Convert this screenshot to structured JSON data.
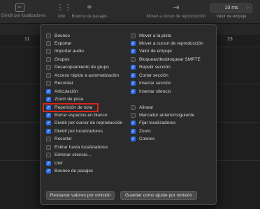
{
  "toolbar": {
    "split_label": "Dividir por localizadores",
    "glue_label": "Unir",
    "bounce_label": "Bounce de pasajes",
    "playhead_label": "Mover a cursor de reproducción",
    "nudge_value": "10 ms",
    "nudge_label": "Valor de empuje"
  },
  "ruler": {
    "left_bar": "11",
    "right_bar": "23"
  },
  "popover": {
    "left_column": [
      {
        "label": "Bounce",
        "checked": false
      },
      {
        "label": "Exportar",
        "checked": false
      },
      {
        "label": "Importar audio",
        "checked": false
      },
      {
        "label": "Grupos",
        "checked": false
      },
      {
        "label": "Desacoplamiento de grupo",
        "checked": false
      },
      {
        "label": "Acceso rápido a automatización",
        "checked": false
      },
      {
        "label": "Recordar",
        "checked": false
      },
      {
        "label": "Articulación",
        "checked": true
      },
      {
        "label": "Zoom de pista",
        "checked": true
      },
      {
        "label": "Repetición de nota",
        "checked": true
      },
      {
        "label": "Borrar espacios en blanco",
        "checked": true
      },
      {
        "label": "Dividir por cursor de reproducción",
        "checked": true
      },
      {
        "label": "Dividir por localizadores",
        "checked": true
      },
      {
        "label": "Recortar",
        "checked": false
      },
      {
        "label": "Estirar hasta localizadores",
        "checked": false
      },
      {
        "label": "Eliminar silencio...",
        "checked": false
      },
      {
        "label": "Unir",
        "checked": true
      },
      {
        "label": "Bounce de pasajes",
        "checked": true
      }
    ],
    "right_column": [
      {
        "label": "Mover a la pista",
        "checked": false
      },
      {
        "label": "Mover a cursor de reproducción",
        "checked": true
      },
      {
        "label": "Valor de empuje",
        "checked": true
      },
      {
        "label": "Bloquear/desbloquear SMPTE",
        "checked": false
      },
      {
        "label": "Repetir sección",
        "checked": true
      },
      {
        "label": "Cortar sección",
        "checked": true
      },
      {
        "label": "Insertar sección",
        "checked": true
      },
      {
        "label": "Insertar silencio",
        "checked": true
      },
      {
        "label": "",
        "checked": false
      },
      {
        "label": "Alinear",
        "checked": false
      },
      {
        "label": "Marcador anterior/siguiente",
        "checked": false
      },
      {
        "label": "Fijar localizadores",
        "checked": true
      },
      {
        "label": "Zoom",
        "checked": true
      },
      {
        "label": "Colores",
        "checked": true
      }
    ],
    "restore_button": "Restaurar valores por omisión",
    "save_button": "Guardar como ajuste por omisión"
  },
  "colors": {
    "accent": "#2a6ff0",
    "highlight": "#d7261c"
  }
}
